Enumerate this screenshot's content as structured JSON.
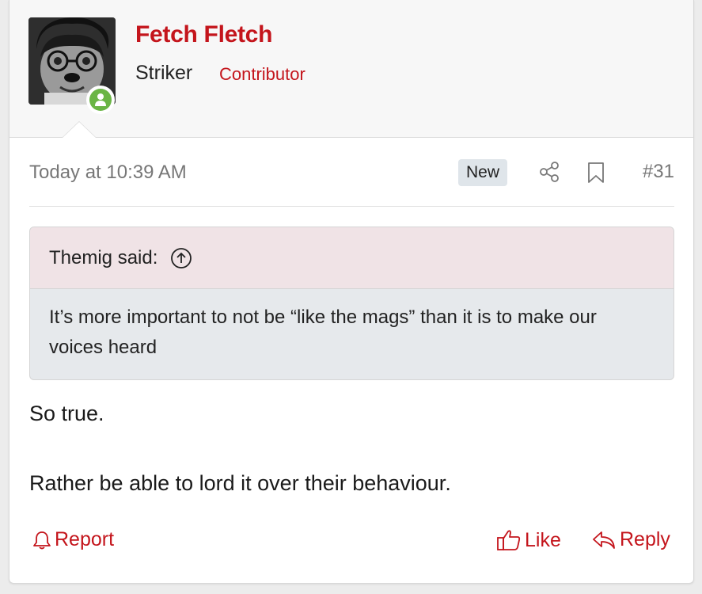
{
  "user": {
    "name": "Fetch Fletch",
    "title": "Striker",
    "banner": "Contributor",
    "avatar_icon": "avatar-photo",
    "status_icon": "online-user-icon"
  },
  "post": {
    "timestamp": "Today at 10:39 AM",
    "new_badge": "New",
    "number": "#31",
    "quote": {
      "author_label": "Themig said:",
      "text": "It’s more important to not be “like the mags” than it is to make our voices heard"
    },
    "body": [
      "So true.",
      "Rather be able to lord it over their behaviour."
    ]
  },
  "actions": {
    "report": "Report",
    "like": "Like",
    "reply": "Reply"
  },
  "colors": {
    "accent": "#c4151c",
    "online": "#6ab545",
    "quote_head_bg": "#f0e3e6",
    "quote_body_bg": "#e6e9ec"
  }
}
